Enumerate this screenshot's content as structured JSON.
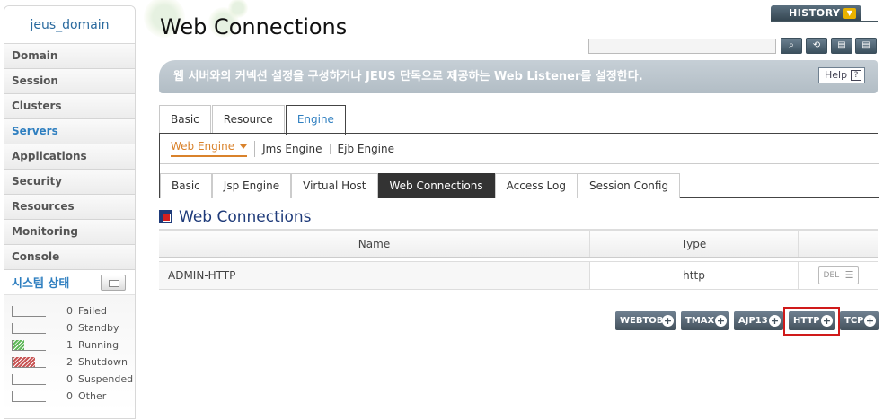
{
  "sidebar": {
    "domain": "jeus_domain",
    "items": [
      {
        "label": "Domain",
        "active": false
      },
      {
        "label": "Session",
        "active": false
      },
      {
        "label": "Clusters",
        "active": false
      },
      {
        "label": "Servers",
        "active": true
      },
      {
        "label": "Applications",
        "active": false
      },
      {
        "label": "Security",
        "active": false
      },
      {
        "label": "Resources",
        "active": false
      },
      {
        "label": "Monitoring",
        "active": false
      },
      {
        "label": "Console",
        "active": false
      }
    ],
    "status_title": "시스템 상태",
    "status": [
      {
        "count": "0",
        "label": "Failed",
        "color": "",
        "fill": 0
      },
      {
        "count": "0",
        "label": "Standby",
        "color": "",
        "fill": 0
      },
      {
        "count": "1",
        "label": "Running",
        "color": "#5fb85a",
        "fill": 0.33
      },
      {
        "count": "2",
        "label": "Shutdown",
        "color": "#c85454",
        "fill": 0.67
      },
      {
        "count": "0",
        "label": "Suspended",
        "color": "",
        "fill": 0
      },
      {
        "count": "0",
        "label": "Other",
        "color": "",
        "fill": 0
      }
    ]
  },
  "header": {
    "title": "Web Connections",
    "history": "HISTORY",
    "description": "웹 서버와의 커넥션 설정을 구성하거나 JEUS 단독으로 제공하는 Web Listener를 설정한다.",
    "help": "Help",
    "tools": [
      "search-icon",
      "refresh-icon",
      "xml-export-icon",
      "xml-import-icon"
    ]
  },
  "tabs_main": [
    "Basic",
    "Resource",
    "Engine"
  ],
  "tabs_engine": [
    "Web Engine",
    "Jms Engine",
    "Ejb Engine"
  ],
  "tabs_web": [
    "Basic",
    "Jsp Engine",
    "Virtual Host",
    "Web Connections",
    "Access Log",
    "Session Config"
  ],
  "section": {
    "title": "Web Connections",
    "columns": {
      "name": "Name",
      "type": "Type"
    },
    "rows": [
      {
        "name": "ADMIN-HTTP",
        "type": "http",
        "action": "DEL"
      }
    ]
  },
  "add_buttons": [
    "WEBTOB",
    "TMAX",
    "AJP13",
    "HTTP",
    "TCP"
  ]
}
